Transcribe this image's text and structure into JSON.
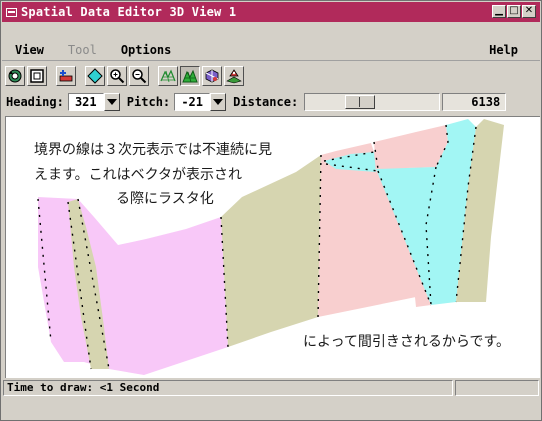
{
  "window": {
    "title": "Spatial Data Editor 3D View 1",
    "title_bar_color": "#b12a5b",
    "controls": [
      "minimize",
      "maximize",
      "close"
    ],
    "control_glyphs": {
      "minimize": "▁",
      "maximize": "□",
      "close": "✕"
    }
  },
  "menu": {
    "items": [
      {
        "label": "View",
        "enabled": true
      },
      {
        "label": "Tool",
        "enabled": false
      },
      {
        "label": "Options",
        "enabled": true
      }
    ],
    "help": "Help"
  },
  "toolbar": {
    "tools": [
      {
        "icon": "rotate-view-icon",
        "pressed": false
      },
      {
        "icon": "frame-view-icon",
        "pressed": false
      },
      {
        "icon": "add-point-icon",
        "pressed": false
      },
      {
        "icon": "diamond-select-icon",
        "pressed": false
      },
      {
        "icon": "zoom-in-icon",
        "pressed": false
      },
      {
        "icon": "zoom-out-icon",
        "pressed": false
      },
      {
        "icon": "terrain-wireframe-icon",
        "pressed": false
      },
      {
        "icon": "terrain-solid-icon",
        "pressed": true
      },
      {
        "icon": "surface-shade-icon",
        "pressed": false
      },
      {
        "icon": "viewer-position-icon",
        "pressed": false
      }
    ]
  },
  "view_controls": {
    "heading_label": "Heading:",
    "heading_value": "321",
    "pitch_label": "Pitch:",
    "pitch_value": "-21",
    "distance_label": "Distance:",
    "distance_value": "6138",
    "distance_slider_fraction": 0.38
  },
  "viewport": {
    "annotation_line1": "境界の線は３次元表示では不連続に見",
    "annotation_line2": "えます。これはベクタが表示され",
    "annotation_line3": "る際にラスタ化",
    "annotation_line4": "によって間引きされるからです。",
    "colors": {
      "pink": "#f8c8f8",
      "olive": "#d6d5b0",
      "salmon": "#f8cfcf",
      "cyan": "#a2f6f4"
    }
  },
  "status": {
    "text": "Time to draw: <1 Second",
    "aux": ""
  }
}
